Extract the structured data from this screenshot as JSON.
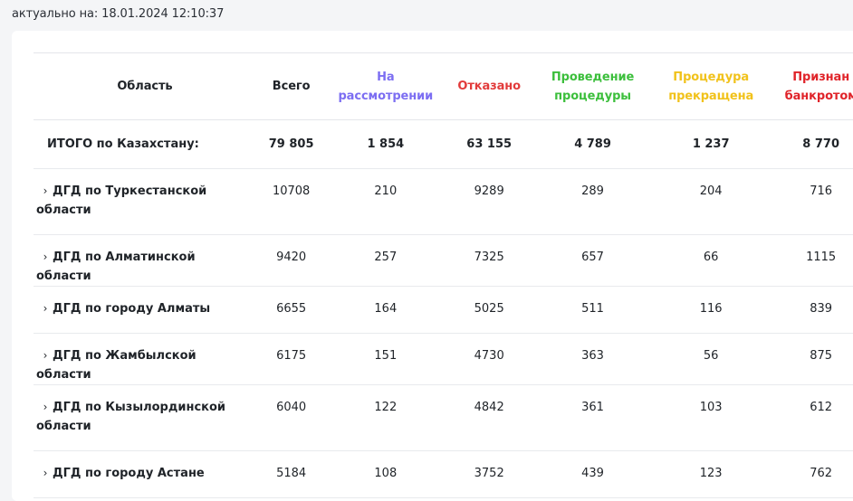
{
  "updated_text": "актуально на: 18.01.2024 12:10:37",
  "columns": {
    "region": "Область",
    "total": "Всего",
    "review": "На рассмотрении",
    "denied": "Отказано",
    "procedure": "Проведение процедуры",
    "stopped": "Процедура прекращена",
    "bankrupt": "Признан банкротом"
  },
  "column_colors": {
    "review": "#7c6ef2",
    "denied": "#e23b3b",
    "procedure": "#3cbf3c",
    "stopped": "#f1c21b",
    "bankrupt": "#e0242a"
  },
  "totals": {
    "label": "ИТОГО по Казахстану:",
    "total": "79 805",
    "review": "1 854",
    "denied": "63 155",
    "procedure": "4 789",
    "stopped": "1 237",
    "bankrupt": "8 770"
  },
  "rows": [
    {
      "region": "ДГД по Туркестанской области",
      "total": "10708",
      "review": "210",
      "denied": "9289",
      "procedure": "289",
      "stopped": "204",
      "bankrupt": "716"
    },
    {
      "region": "ДГД по Алматинской области",
      "total": "9420",
      "review": "257",
      "denied": "7325",
      "procedure": "657",
      "stopped": "66",
      "bankrupt": "1115"
    },
    {
      "region": "ДГД по городу Алматы",
      "total": "6655",
      "review": "164",
      "denied": "5025",
      "procedure": "511",
      "stopped": "116",
      "bankrupt": "839"
    },
    {
      "region": "ДГД по Жамбылской области",
      "total": "6175",
      "review": "151",
      "denied": "4730",
      "procedure": "363",
      "stopped": "56",
      "bankrupt": "875"
    },
    {
      "region": "ДГД по Кызылординской области",
      "total": "6040",
      "review": "122",
      "denied": "4842",
      "procedure": "361",
      "stopped": "103",
      "bankrupt": "612"
    },
    {
      "region": "ДГД по городу Астане",
      "total": "5184",
      "review": "108",
      "denied": "3752",
      "procedure": "439",
      "stopped": "123",
      "bankrupt": "762"
    }
  ],
  "icons": {
    "expand": "chevron-right-icon"
  }
}
